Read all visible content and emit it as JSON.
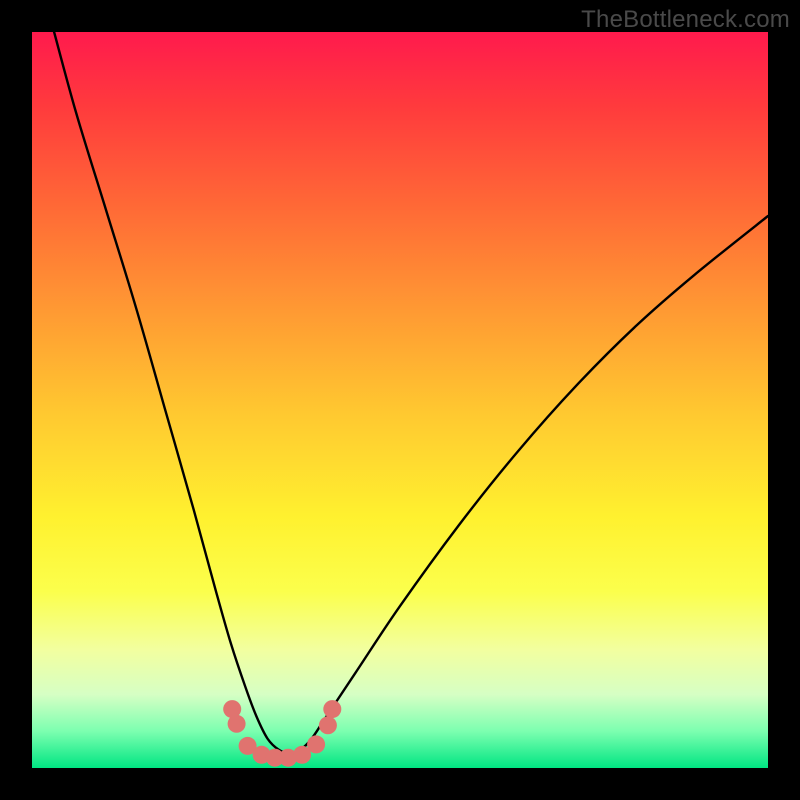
{
  "watermark": "TheBottleneck.com",
  "chart_data": {
    "type": "line",
    "title": "",
    "xlabel": "",
    "ylabel": "",
    "ylim": [
      0,
      100
    ],
    "xlim": [
      0,
      100
    ],
    "series": [
      {
        "name": "curve",
        "x": [
          3,
          6,
          10,
          14,
          18,
          22,
          25,
          27,
          29,
          30.5,
          32,
          33.5,
          35,
          36.5,
          38,
          40,
          44,
          50,
          58,
          66,
          74,
          82,
          90,
          100
        ],
        "y": [
          100,
          89,
          76,
          63,
          49,
          35,
          24,
          17,
          11,
          7,
          4,
          2.5,
          2,
          2.5,
          4,
          7,
          13,
          22,
          33,
          43,
          52,
          60,
          67,
          75
        ]
      }
    ],
    "markers": {
      "name": "low-points",
      "color": "#e0736f",
      "points": [
        {
          "x": 27.2,
          "y": 8.0
        },
        {
          "x": 27.8,
          "y": 6.0
        },
        {
          "x": 29.3,
          "y": 3.0
        },
        {
          "x": 31.2,
          "y": 1.8
        },
        {
          "x": 33.0,
          "y": 1.4
        },
        {
          "x": 34.8,
          "y": 1.4
        },
        {
          "x": 36.7,
          "y": 1.8
        },
        {
          "x": 38.6,
          "y": 3.2
        },
        {
          "x": 40.2,
          "y": 5.8
        },
        {
          "x": 40.8,
          "y": 8.0
        }
      ]
    },
    "gradient_stops": [
      {
        "pos": 0,
        "color": "#ff1a4d"
      },
      {
        "pos": 10,
        "color": "#ff3a3d"
      },
      {
        "pos": 24,
        "color": "#ff6a36"
      },
      {
        "pos": 38,
        "color": "#ff9a33"
      },
      {
        "pos": 52,
        "color": "#ffc930"
      },
      {
        "pos": 66,
        "color": "#fff12f"
      },
      {
        "pos": 76,
        "color": "#fbff4c"
      },
      {
        "pos": 84,
        "color": "#f2ffa0"
      },
      {
        "pos": 90,
        "color": "#d6ffc4"
      },
      {
        "pos": 95,
        "color": "#7cffb0"
      },
      {
        "pos": 100,
        "color": "#00e582"
      }
    ]
  }
}
